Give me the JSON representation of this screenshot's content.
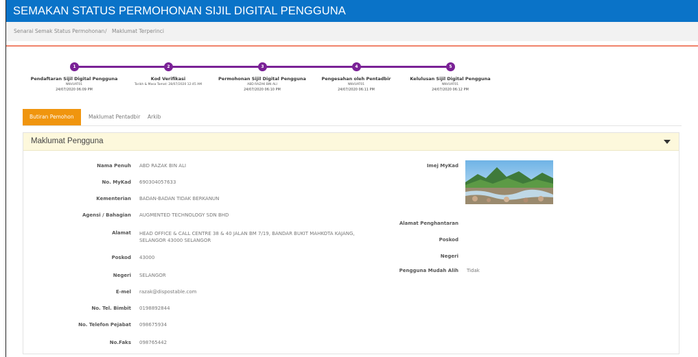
{
  "header": {
    "title": "SEMAKAN STATUS PERMOHONAN SIJIL DIGITAL PENGGUNA"
  },
  "breadcrumb": {
    "item1": "Senarai Semak Status Permohonan",
    "separator": "/",
    "item2": "Maklumat Terperinci"
  },
  "steps": [
    {
      "num": "1",
      "title": "Pendaftaran Sijil Digital Pengguna",
      "sub": "NNVUAT01",
      "date": "24/07/2020 06:09 PM"
    },
    {
      "num": "2",
      "title": "Kod Verifikasi",
      "sub": "Tarikh & Masa Tamat: 28/07/2020 12:45 AM",
      "date": ""
    },
    {
      "num": "3",
      "title": "Permohonan Sijil Digital Pengguna",
      "sub": "ABD RAZAK BIN ALI",
      "date": "24/07/2020 06:10 PM"
    },
    {
      "num": "4",
      "title": "Pengesahan oleh Pentadbir",
      "sub": "NNVUAT01",
      "date": "24/07/2020 06:11 PM"
    },
    {
      "num": "5",
      "title": "Kelulusan Sijil Digital Pengguna",
      "sub": "NNVUAT01",
      "date": "24/07/2020 06:12 PM"
    }
  ],
  "tabs": [
    {
      "label": "Butiran Pemohon",
      "active": true
    },
    {
      "label": "Maklumat Pentadbir",
      "active": false
    },
    {
      "label": "Arkib",
      "active": false
    }
  ],
  "panel": {
    "title": "Maklumat Pengguna"
  },
  "left_fields": [
    {
      "label": "Nama Penuh",
      "value": "ABD RAZAK BIN ALI"
    },
    {
      "label": "No. MyKad",
      "value": "690304057633"
    },
    {
      "label": "Kementerian",
      "value": "BADAN-BADAN TIDAK BERKANUN"
    },
    {
      "label": "Agensi / Bahagian",
      "value": "AUGMENTED TECHNOLOGY SDN BHD"
    },
    {
      "label": "Alamat",
      "value": "HEAD OFFICE & CALL CENTRE 38 & 40 JALAN BM 7/19, BANDAR BUKIT MAHKOTA KAJANG, SELANGOR 43000 SELANGOR"
    },
    {
      "label": "Poskod",
      "value": "43000"
    },
    {
      "label": "Negeri",
      "value": "SELANGOR"
    },
    {
      "label": "E-mel",
      "value": "razak@dispostable.com"
    },
    {
      "label": "No. Tel. Bimbit",
      "value": "0198892844"
    },
    {
      "label": "No. Telefon Pejabat",
      "value": "098675934"
    },
    {
      "label": "No.Faks",
      "value": "098765442"
    }
  ],
  "right_fields": [
    {
      "label": "Imej MyKad",
      "value": ""
    },
    {
      "label": "Alamat Penghantaran",
      "value": ""
    },
    {
      "label": "Poskod",
      "value": ""
    },
    {
      "label": "Negeri",
      "value": ""
    },
    {
      "label": "Pengguna Mudah Alih",
      "value": "Tidak"
    }
  ],
  "colors": {
    "header": "#0a73c8",
    "step": "#7a2196",
    "tab_active": "#f0950e",
    "panel_head": "#fdf8dc",
    "divider": "#f0826a"
  },
  "icons": {
    "panel_toggle": "caret-down-icon",
    "mykad_image": "landscape-photo"
  }
}
